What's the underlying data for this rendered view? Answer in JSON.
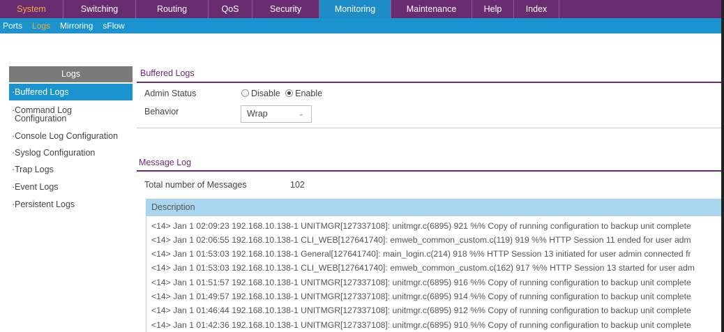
{
  "topnav": {
    "tabs": [
      {
        "label": "System",
        "w": 91
      },
      {
        "label": "Switching",
        "w": 104
      },
      {
        "label": "Routing",
        "w": 104
      },
      {
        "label": "QoS",
        "w": 63
      },
      {
        "label": "Security",
        "w": 96
      },
      {
        "label": "Monitoring",
        "w": 103
      },
      {
        "label": "Maintenance",
        "w": 116
      },
      {
        "label": "Help",
        "w": 60
      },
      {
        "label": "Index",
        "w": 65
      }
    ],
    "active": "Monitoring"
  },
  "subnav": {
    "items": [
      "Ports",
      "Logs",
      "Mirroring",
      "sFlow"
    ],
    "active": "Logs"
  },
  "sidebar": {
    "title": "Logs",
    "items": [
      "Buffered Logs",
      "Command Log Configuration",
      "Console Log Configuration",
      "Syslog Configuration",
      "Trap Logs",
      "Event Logs",
      "Persistent Logs"
    ],
    "active_index": 0
  },
  "buffered": {
    "title": "Buffered Logs",
    "admin_status_label": "Admin Status",
    "disable_label": "Disable",
    "enable_label": "Enable",
    "behavior_label": "Behavior",
    "behavior_value": "Wrap"
  },
  "messagelog": {
    "title": "Message Log",
    "total_label": "Total number of Messages",
    "total_value": "102",
    "desc_header": "Description",
    "rows": [
      "<14> Jan 1 02:09:23 192.168.10.138-1 UNITMGR[127337108]: unitmgr.c(6895) 921 %% Copy of running configuration to backup unit complete",
      "<14> Jan 1 02:06:55 192.168.10.138-1 CLI_WEB[127641740]: emweb_common_custom.c(119) 919 %% HTTP Session 11 ended for user adm",
      "<14> Jan 1 01:53:03 192.168.10.138-1 General[127641740]: main_login.c(214) 918 %% HTTP Session 13 initiated for user admin connected fr",
      "<14> Jan 1 01:53:03 192.168.10.138-1 CLI_WEB[127641740]: emweb_common_custom.c(162) 917 %% HTTP Session 13 started for user adm",
      "<14> Jan 1 01:51:57 192.168.10.138-1 UNITMGR[127337108]: unitmgr.c(6895) 916 %% Copy of running configuration to backup unit complete",
      "<14> Jan 1 01:49:57 192.168.10.138-1 UNITMGR[127337108]: unitmgr.c(6895) 914 %% Copy of running configuration to backup unit complete",
      "<14> Jan 1 01:46:44 192.168.10.138-1 UNITMGR[127337108]: unitmgr.c(6895) 912 %% Copy of running configuration to backup unit complete",
      "<14> Jan 1 01:42:36 192.168.10.138-1 UNITMGR[127337108]: unitmgr.c(6895) 910 %% Copy of running configuration to backup unit complete"
    ]
  }
}
